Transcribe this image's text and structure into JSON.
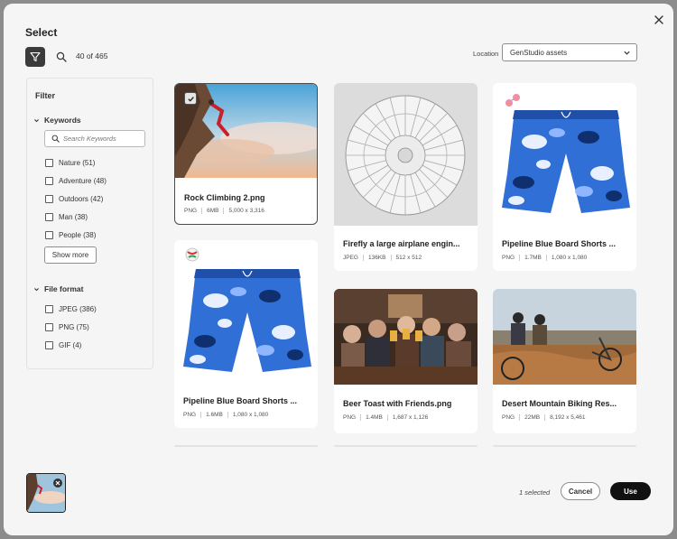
{
  "dialog": {
    "title": "Select",
    "close_icon": "close-icon"
  },
  "toolbar": {
    "filter_icon": "filter-icon",
    "search_icon": "search-icon",
    "count": "40 of 465"
  },
  "location": {
    "label": "Location",
    "value": "GenStudio assets"
  },
  "filter": {
    "title": "Filter",
    "keywords": {
      "heading": "Keywords",
      "search_placeholder": "Search Keywords",
      "options": [
        "Nature (51)",
        "Adventure (48)",
        "Outdoors (42)",
        "Man (38)",
        "People (38)"
      ],
      "show_more": "Show more"
    },
    "file_format": {
      "heading": "File format",
      "options": [
        "JPEG (386)",
        "PNG (75)",
        "GIF (4)"
      ]
    }
  },
  "assets": [
    {
      "name": "Rock Climbing 2.png",
      "format": "PNG",
      "size": "6MB",
      "dimensions": "5,000 x 3,316",
      "selected": true
    },
    {
      "name": "Firefly a large airplane engin...",
      "format": "JPEG",
      "size": "136KB",
      "dimensions": "512 x 512",
      "selected": false
    },
    {
      "name": "Pipeline Blue Board Shorts ...",
      "format": "PNG",
      "size": "1.7MB",
      "dimensions": "1,080 x 1,080",
      "selected": false
    },
    {
      "name": "Pipeline Blue Board Shorts ...",
      "format": "PNG",
      "size": "1.6MB",
      "dimensions": "1,080 x 1,080",
      "selected": false
    },
    {
      "name": "Beer Toast with Friends.png",
      "format": "PNG",
      "size": "1.4MB",
      "dimensions": "1,687 x 1,126",
      "selected": false
    },
    {
      "name": "Desert Mountain Biking Res...",
      "format": "PNG",
      "size": "22MB",
      "dimensions": "8,192 x 5,461",
      "selected": false
    }
  ],
  "footer": {
    "selected_text": "1 selected",
    "cancel": "Cancel",
    "use": "Use"
  },
  "colors": {
    "primary": "#111111",
    "panel": "#f5f5f5",
    "card": "#ffffff",
    "shorts_blue": "#2f6fd6"
  }
}
